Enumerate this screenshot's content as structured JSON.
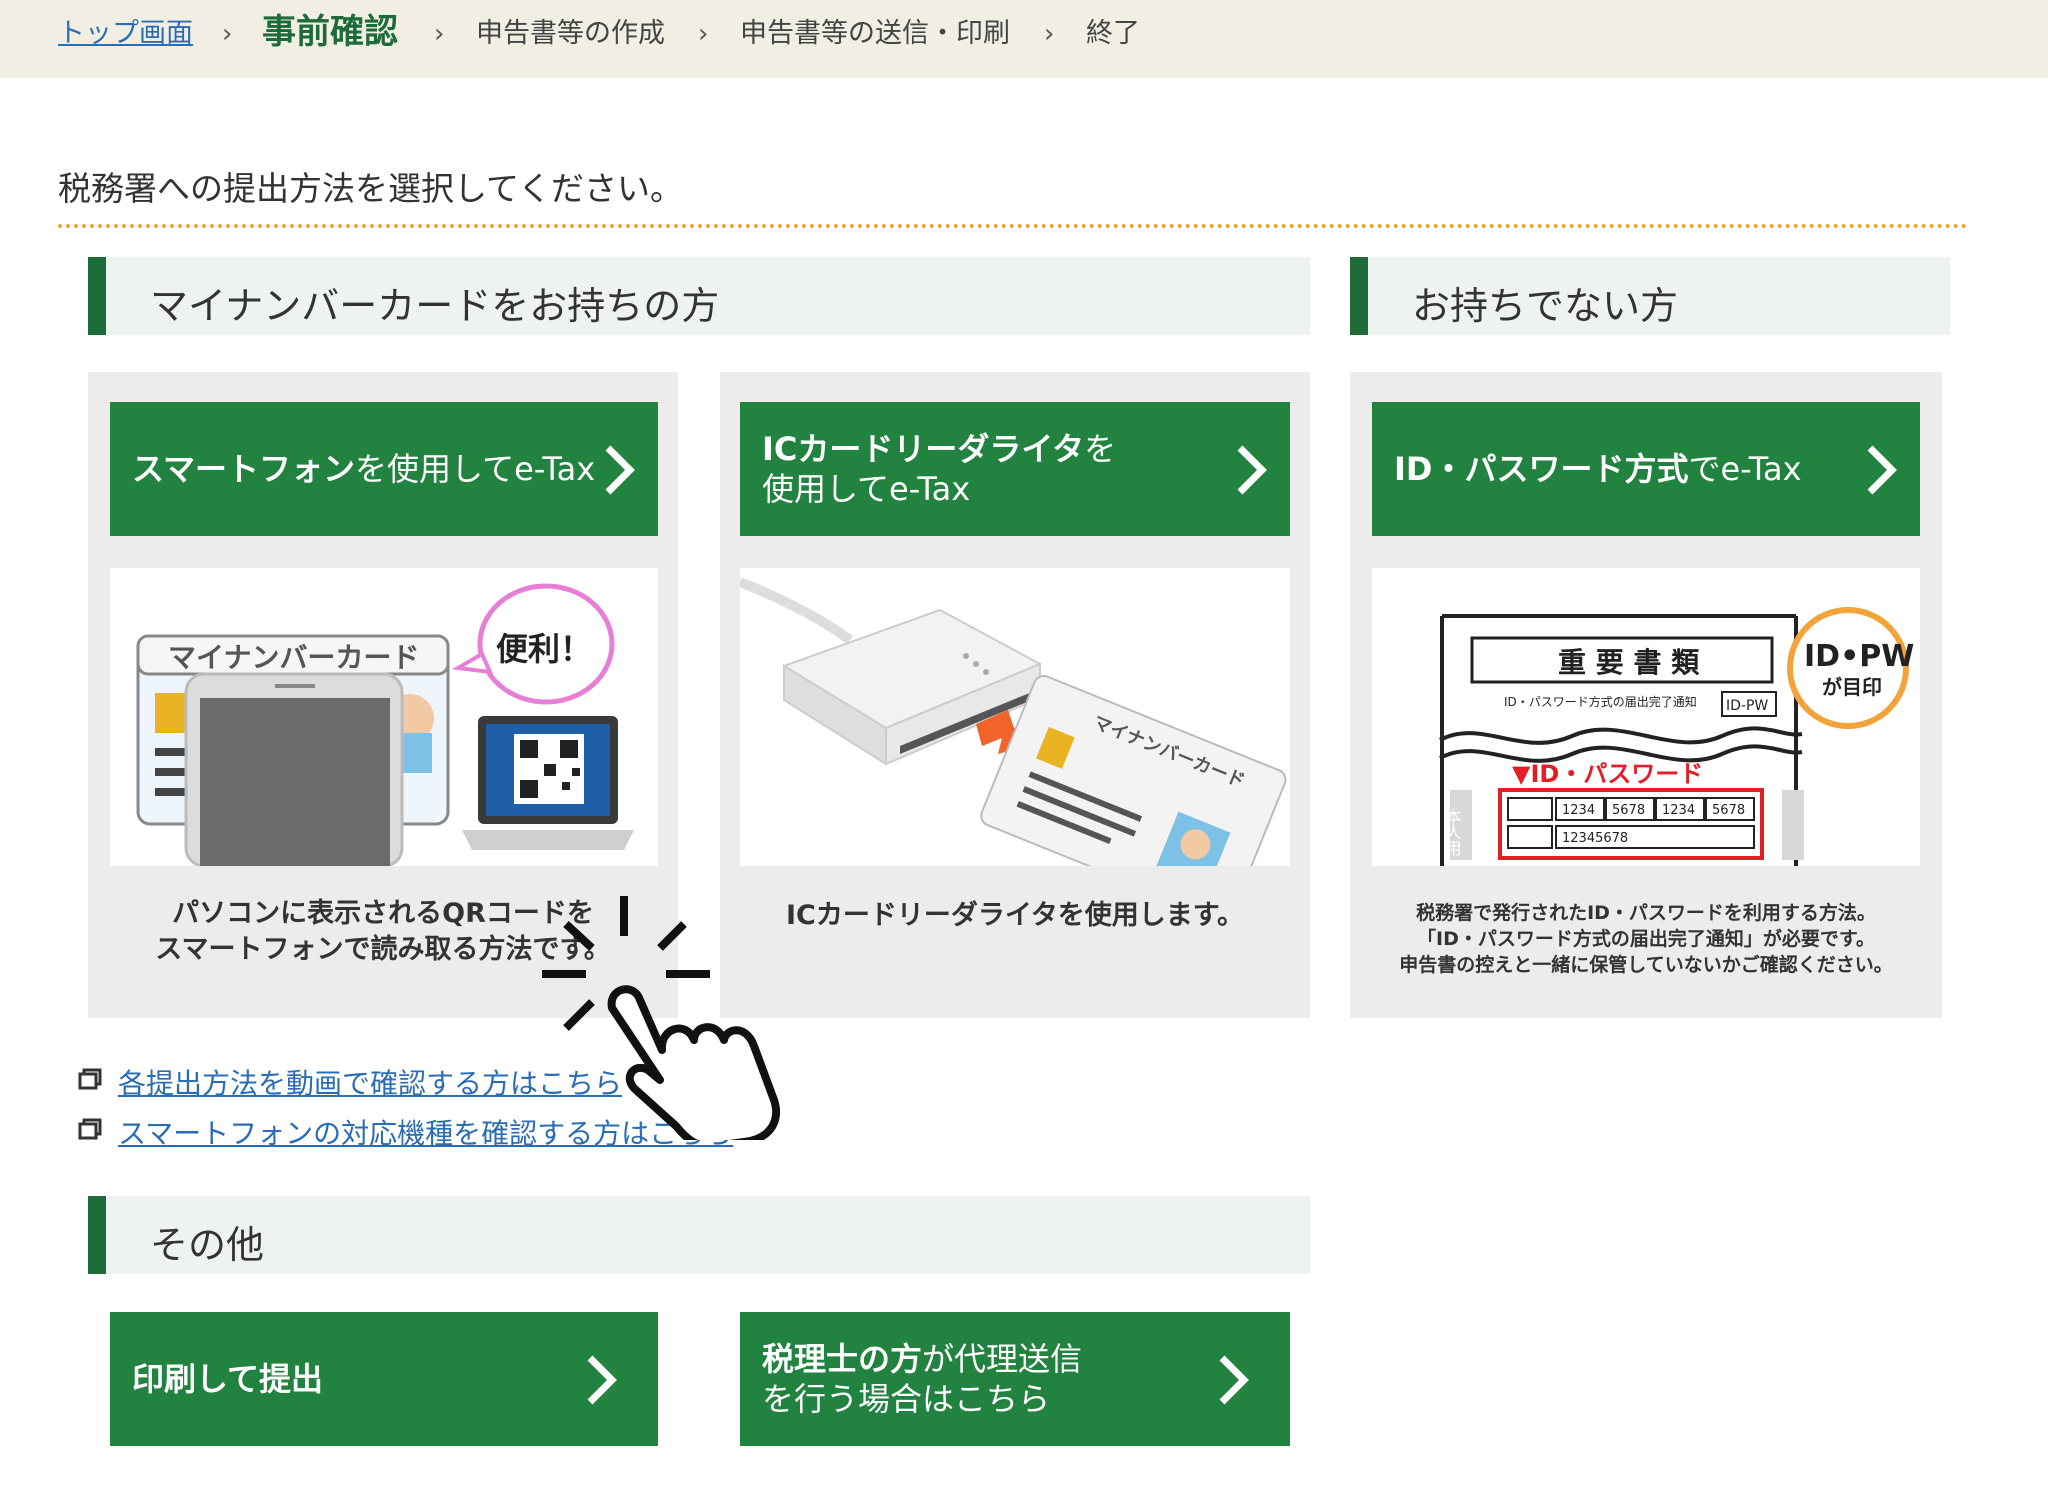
{
  "breadcrumb": {
    "top": "トップ画面",
    "step1": "事前確認",
    "step2": "申告書等の作成",
    "step3": "申告書等の送信・印刷",
    "step4": "終了",
    "separator": "›"
  },
  "instruction": "税務署への提出方法を選択してください。",
  "sections": {
    "mynumber": {
      "title": "マイナンバーカードをお持ちの方"
    },
    "no_card": {
      "title": "お持ちでない方"
    },
    "other": {
      "title": "その他"
    }
  },
  "options": {
    "smartphone": {
      "label_bold": "スマートフォン",
      "label_rest": "を使用してe-Tax",
      "illus_card_title": "マイナンバーカード",
      "illus_bubble": "便利！",
      "desc_line1": "パソコンに表示されるQRコードを",
      "desc_line2": "スマートフォンで読み取る方法です。"
    },
    "icreader": {
      "label_line1_bold": "ICカードリーダライタ",
      "label_line1_rest": "を",
      "label_line2": "使用してe-Tax",
      "illus_card_title": "マイナンバーカード",
      "desc": "ICカードリーダライタを使用します。"
    },
    "idpw": {
      "label_bold": "ID・パスワード方式",
      "label_rest": "でe-Tax",
      "illus_doc_title": "重 要 書 類",
      "illus_doc_sub": "ID・パスワード方式の届出完了通知",
      "illus_badge_line1": "ID•PW",
      "illus_badge_line2": "が目印",
      "illus_red_title": "▼ID・パスワード",
      "illus_codes": [
        "1234",
        "5678",
        "1234",
        "5678"
      ],
      "illus_code2": "12345678",
      "illus_side": "本人用",
      "desc_line1": "税務署で発行されたID・パスワードを利用する方法。",
      "desc_line2": "「ID・パスワード方式の届出完了通知」が必要です。",
      "desc_line3": "申告書の控えと一緒に保管していないかご確認ください。"
    },
    "print": {
      "label": "印刷して提出"
    },
    "tax_accountant": {
      "label_line1_bold": "税理士の方",
      "label_line1_rest": "が代理送信",
      "label_line2": "を行う場合はこちら"
    }
  },
  "links": {
    "video": "各提出方法を動画で確認する方はこちら",
    "smartphone_models": "スマートフォンの対応機種を確認する方はこちら"
  },
  "icons": {
    "chevron": "chevron-right-icon",
    "external": "new-window-icon",
    "cursor": "tap-hand-cursor-icon"
  },
  "colors": {
    "brand_green": "#22823f",
    "dark_green": "#1e6b3a",
    "link_blue": "#2a6db4",
    "accent_orange": "#f0a43a",
    "breadcrumb_bg": "#f1efe4",
    "panel_bg": "#ececec"
  }
}
